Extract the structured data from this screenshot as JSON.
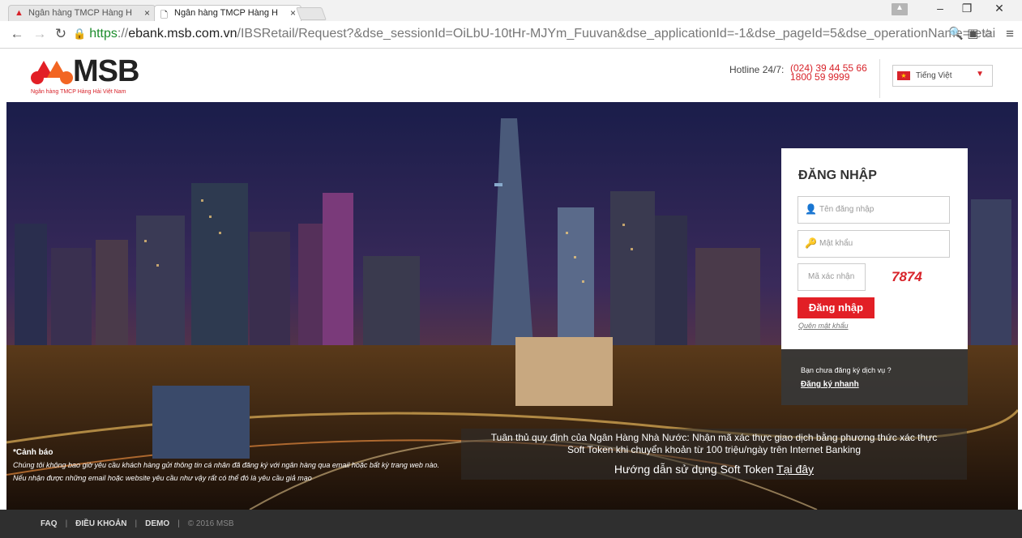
{
  "browser": {
    "tabs": [
      {
        "title": "Ngân hàng TMCP Hàng H",
        "active": false
      },
      {
        "title": "Ngân hàng TMCP Hàng H",
        "active": true
      }
    ],
    "url": {
      "scheme": "https",
      "host": "ebank.msb.com.vn",
      "path": "/IBSRetail/Request?&dse_sessionId=OiLbU-10tHr-MJYm_Fuuvan&dse_applicationId=-1&dse_pageId=5&dse_operationName=retailIndex"
    }
  },
  "header": {
    "logo_text": "MSB",
    "logo_sub": "Ngân hàng TMCP Hàng Hải Việt Nam",
    "hotline_label": "Hotline 24/7:",
    "hotline_1": "(024) 39 44 55 66",
    "hotline_2": "1800 59 9999",
    "language": "Tiếng Việt"
  },
  "login": {
    "title": "ĐĂNG NHẬP",
    "username_placeholder": "Tên đăng nhập",
    "password_placeholder": "Mật khẩu",
    "captcha_placeholder": "Mã xác nhận",
    "captcha_code": "7874",
    "login_button": "Đăng nhập",
    "forgot_password": "Quên mật khẩu",
    "register_question": "Bạn chưa đăng ký dịch vụ ?",
    "register_link": "Đăng ký nhanh"
  },
  "notice": {
    "line1": "Tuân thủ quy định của Ngân Hàng Nhà Nước: Nhận mã xác thực giao dịch bằng phương thức xác thực",
    "line2": "Soft Token khi chuyển khoản từ 100 triệu/ngày trên Internet Banking",
    "guide_text": "Hướng dẫn sử dụng Soft Token",
    "guide_link": "Tại đây"
  },
  "warning": {
    "title": "*Cảnh báo",
    "text": "Chúng tôi không bao giờ yêu cầu khách hàng gửi thông tin cá nhân đã đăng ký với ngân hàng qua email hoặc bất kỳ trang web nào. Nếu nhận được những email hoặc website yêu cầu như vậy rất có thể đó là yêu cầu giả mạo"
  },
  "footer": {
    "faq": "FAQ",
    "terms": "ĐIỀU KHOẢN",
    "demo": "DEMO",
    "copyright": "© 2016 MSB"
  },
  "colors": {
    "brand_red": "#e21f26",
    "footer_bg": "#2f2f2f"
  }
}
